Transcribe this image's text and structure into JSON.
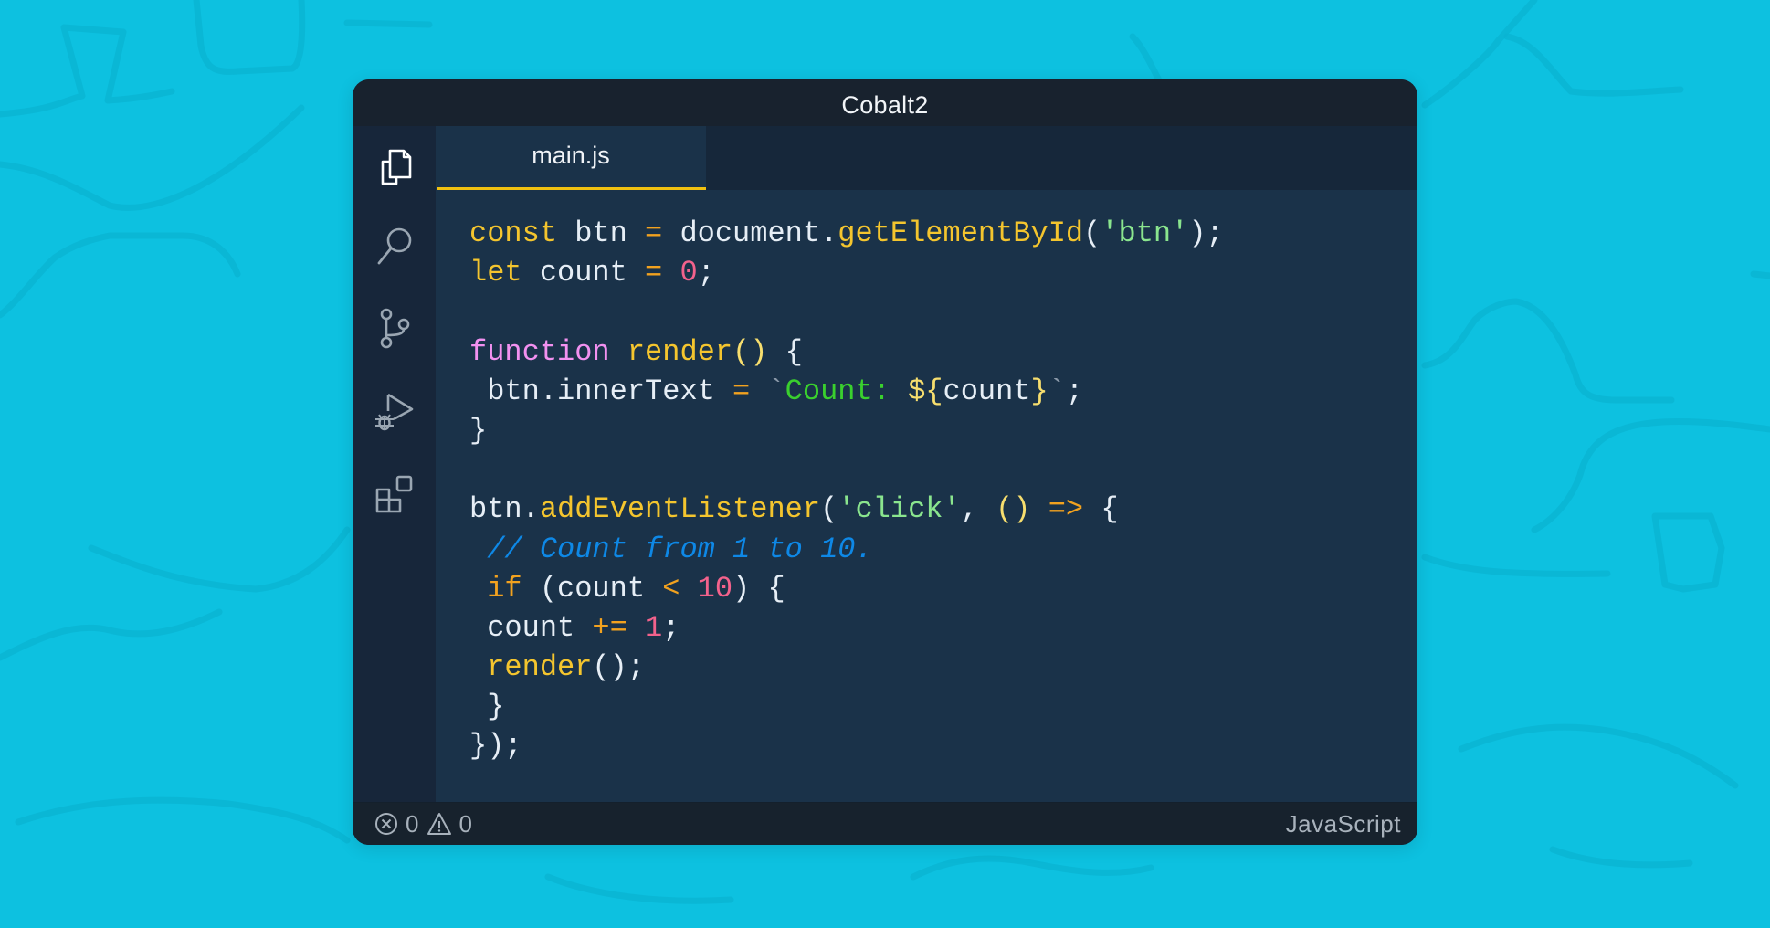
{
  "window": {
    "title": "Cobalt2"
  },
  "activity_bar": {
    "items": [
      {
        "id": "explorer",
        "icon": "files-icon",
        "active": true
      },
      {
        "id": "search",
        "icon": "search-icon",
        "active": false
      },
      {
        "id": "source-control",
        "icon": "source-control-icon",
        "active": false
      },
      {
        "id": "run-debug",
        "icon": "run-debug-icon",
        "active": false
      },
      {
        "id": "extensions",
        "icon": "extensions-icon",
        "active": false
      }
    ]
  },
  "tabs": [
    {
      "label": "main.js",
      "active": true
    }
  ],
  "editor": {
    "language": "JavaScript",
    "lines": [
      [
        [
          "kw-y",
          "const"
        ],
        [
          "punc",
          " btn "
        ],
        [
          "op",
          "="
        ],
        [
          "punc",
          " document."
        ],
        [
          "fn",
          "getElementById"
        ],
        [
          "punc",
          "("
        ],
        [
          "str",
          "'btn'"
        ],
        [
          "punc",
          ");"
        ]
      ],
      [
        [
          "kw-y",
          "let"
        ],
        [
          "punc",
          " count "
        ],
        [
          "op",
          "="
        ],
        [
          "punc",
          " "
        ],
        [
          "num",
          "0"
        ],
        [
          "punc",
          ";"
        ]
      ],
      [],
      [
        [
          "kw-p",
          "function"
        ],
        [
          "punc",
          " "
        ],
        [
          "fn",
          "render"
        ],
        [
          "paren-y",
          "()"
        ],
        [
          "punc",
          " {"
        ]
      ],
      [
        [
          "punc",
          " btn.innerText "
        ],
        [
          "op",
          "="
        ],
        [
          "punc",
          " "
        ],
        [
          "bt",
          "`"
        ],
        [
          "tpl",
          "Count: "
        ],
        [
          "paren-y",
          "${"
        ],
        [
          "punc",
          "count"
        ],
        [
          "paren-y",
          "}"
        ],
        [
          "bt",
          "`"
        ],
        [
          "punc",
          ";"
        ]
      ],
      [
        [
          "punc",
          "}"
        ]
      ],
      [],
      [
        [
          "punc",
          "btn."
        ],
        [
          "fn",
          "addEventListener"
        ],
        [
          "punc",
          "("
        ],
        [
          "str",
          "'click'"
        ],
        [
          "punc",
          ", "
        ],
        [
          "paren-y",
          "()"
        ],
        [
          "punc",
          " "
        ],
        [
          "op",
          "=>"
        ],
        [
          "punc",
          " {"
        ]
      ],
      [
        [
          "cmt",
          " // Count from 1 to 10."
        ]
      ],
      [
        [
          "punc",
          " "
        ],
        [
          "op",
          "if"
        ],
        [
          "punc",
          " (count "
        ],
        [
          "op",
          "<"
        ],
        [
          "punc",
          " "
        ],
        [
          "num",
          "10"
        ],
        [
          "punc",
          ") {"
        ]
      ],
      [
        [
          "punc",
          " count "
        ],
        [
          "op",
          "+="
        ],
        [
          "punc",
          " "
        ],
        [
          "num",
          "1"
        ],
        [
          "punc",
          ";"
        ]
      ],
      [
        [
          "punc",
          " "
        ],
        [
          "fn",
          "render"
        ],
        [
          "punc",
          "();"
        ]
      ],
      [
        [
          "punc",
          " }"
        ]
      ],
      [
        [
          "punc",
          "});"
        ]
      ]
    ]
  },
  "status_bar": {
    "errors": "0",
    "warnings": "0",
    "language": "JavaScript"
  },
  "colors": {
    "background": "#0DC1E0",
    "window": "#17222F",
    "editor": "#1A3249",
    "tab_underline": "#F0C010"
  }
}
